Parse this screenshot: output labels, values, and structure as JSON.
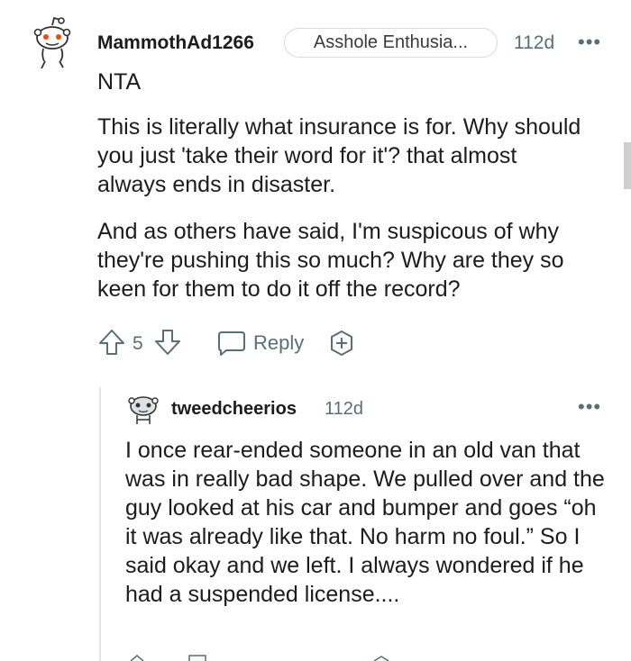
{
  "comment": {
    "username": "MammothAd1266",
    "flair": "Asshole Enthusia...",
    "age": "112d",
    "more": "•••",
    "paragraphs": [
      "NTA",
      "This is literally what insurance is for. Why should you just 'take their word for it'? that almost always ends in disaster.",
      "And as others have said, I'm suspicous of why they're pushing this so much? Why are they so keen for them to do it off the record?"
    ],
    "vote_count": "5",
    "reply_label": "Reply"
  },
  "reply": {
    "username": "tweedcheerios",
    "age": "112d",
    "more": "•••",
    "text": "I once rear-ended someone in an old van that was in really bad shape. We pulled over and the guy looked at his car and bumper and goes “oh it was already like that. No harm no foul.” So I said okay and we left. I always wondered if he had a suspended license...."
  },
  "colors": {
    "text": "#1c1c1c",
    "meta": "#576f76",
    "snoo_accent": "#ff4500",
    "flair_border": "#d9d9d9"
  }
}
